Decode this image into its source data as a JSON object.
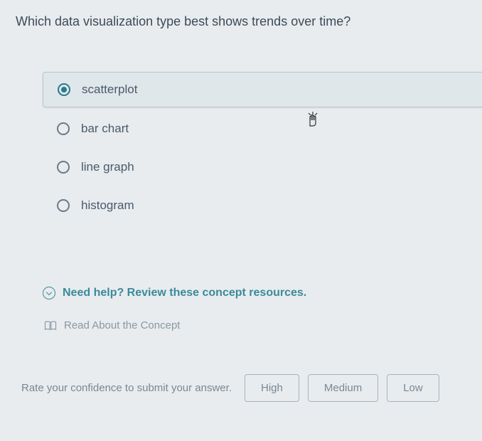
{
  "question": "Which data visualization type best shows trends over time?",
  "options": [
    {
      "label": "scatterplot",
      "selected": true
    },
    {
      "label": "bar chart",
      "selected": false
    },
    {
      "label": "line graph",
      "selected": false
    },
    {
      "label": "histogram",
      "selected": false
    }
  ],
  "help": {
    "header": "Need help? Review these concept resources.",
    "resource": "Read About the Concept"
  },
  "confidence": {
    "label": "Rate your confidence to submit your answer.",
    "buttons": [
      "High",
      "Medium",
      "Low"
    ]
  }
}
